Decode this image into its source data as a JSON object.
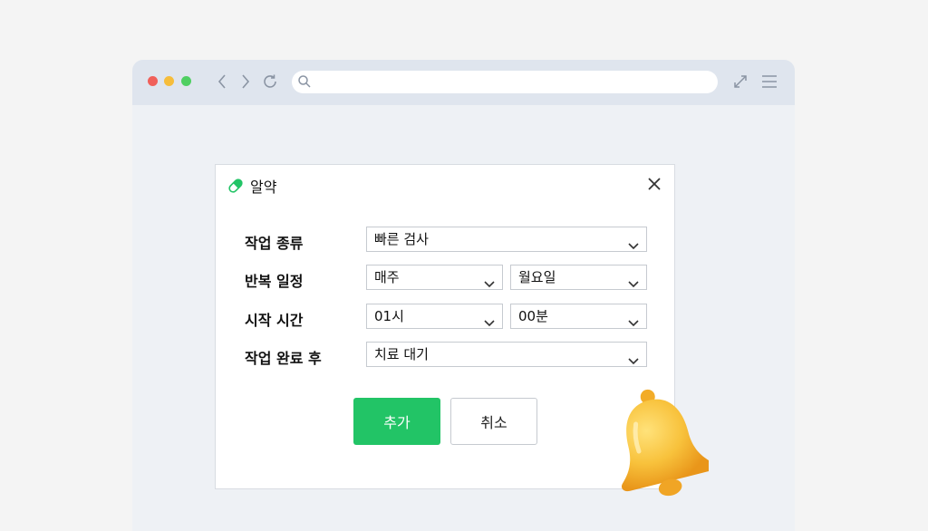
{
  "dialog": {
    "title": "알약",
    "rows": [
      {
        "label": "작업 종류",
        "selects": [
          "빠른 검사"
        ]
      },
      {
        "label": "반복 일정",
        "selects": [
          "매주",
          "월요일"
        ]
      },
      {
        "label": "시작 시간",
        "selects": [
          "01시",
          "00분"
        ]
      },
      {
        "label": "작업 완료 후",
        "selects": [
          "치료 대기"
        ]
      }
    ],
    "add_label": "추가",
    "cancel_label": "취소"
  },
  "colors": {
    "accent": "#22c466",
    "bell": "#f7b733"
  }
}
